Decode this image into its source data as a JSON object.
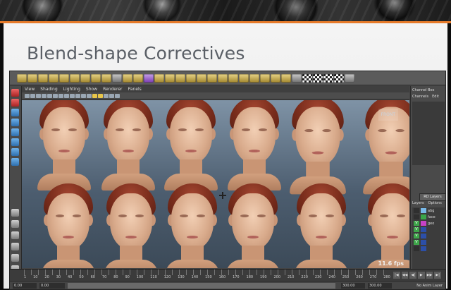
{
  "slide": {
    "title": "Blend-shape Correctives",
    "accent_color": "#e77b2a"
  },
  "maya": {
    "viewport_menu": [
      "View",
      "Shading",
      "Lighting",
      "Show",
      "Renderer",
      "Panels"
    ],
    "view_label": "FRONT",
    "fps": "11.6 fps",
    "channel_box": {
      "title": "Channel Box",
      "tabs": [
        "Channels",
        "Edit"
      ]
    },
    "layers": {
      "button": "RD Layers",
      "tabs": [
        "Layers",
        "Options"
      ],
      "items": [
        {
          "visible": "",
          "color": "#78b9e8",
          "name": "abg"
        },
        {
          "visible": "",
          "color": "#3aa64a",
          "name": "face"
        },
        {
          "visible": "V",
          "color": "#c642c6",
          "name": "geo"
        },
        {
          "visible": "V",
          "color": "#2c4fa8",
          "name": ""
        },
        {
          "visible": "V",
          "color": "#2c4fa8",
          "name": ""
        },
        {
          "visible": "V",
          "color": "#2c4fa8",
          "name": ""
        },
        {
          "visible": "",
          "color": "#2c4fa8",
          "name": ""
        }
      ]
    },
    "timeline": {
      "ticks": [
        "1",
        "10",
        "20",
        "30",
        "40",
        "50",
        "60",
        "70",
        "80",
        "90",
        "100",
        "110",
        "120",
        "130",
        "140",
        "150",
        "160",
        "170",
        "180",
        "190",
        "200",
        "210",
        "220",
        "230",
        "240",
        "250",
        "260",
        "270",
        "280"
      ],
      "play_controls": [
        "|◀",
        "◀◀",
        "◀|",
        "▶",
        "▶▶",
        "▶|"
      ]
    },
    "range": {
      "start": "0.00",
      "inner_start": "0.00",
      "end": "300.00",
      "outer_end": "300.00",
      "anim_layer": "No Anim Layer"
    }
  }
}
